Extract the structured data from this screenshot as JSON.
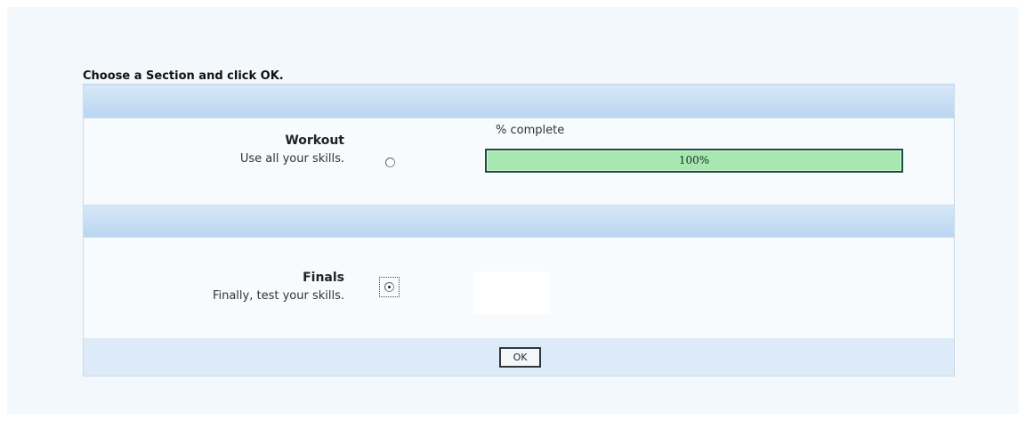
{
  "instructions": "Choose a Section and click OK.",
  "sections": [
    {
      "title": "Workout",
      "description": "Use all your skills.",
      "selected": false,
      "progress": {
        "caption": "% complete",
        "percent": 100,
        "label": "100%"
      }
    },
    {
      "title": "Finals",
      "description": "Finally, test your skills.",
      "selected": true
    }
  ],
  "ok_label": "OK",
  "colors": {
    "page_background": "#f2f8fc",
    "header_gradient_top": "#d7e8f7",
    "header_gradient_bottom": "#b9d6f1",
    "progress_fill": "#a7e8b0",
    "progress_border": "#1f4d3c",
    "footer_background": "#dcebf7"
  }
}
